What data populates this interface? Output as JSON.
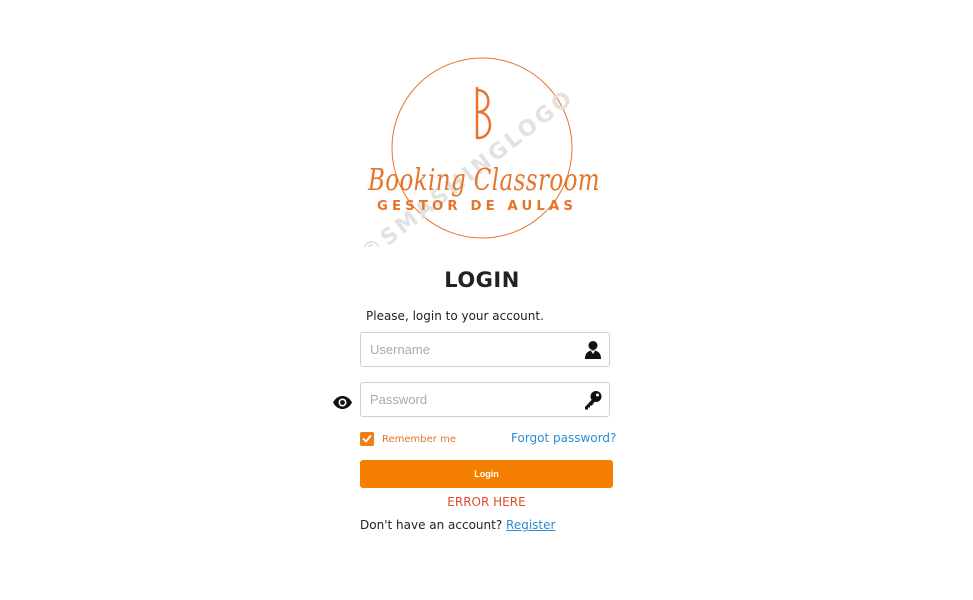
{
  "logo": {
    "title": "Booking Classroom",
    "subtitle": "GESTOR DE AULAS",
    "watermark": "©SMASHINGLOGO",
    "accent_color": "#e8742a"
  },
  "login": {
    "title": "LOGIN",
    "subtitle": "Please, login to your account.",
    "username_placeholder": "Username",
    "username_icon": "user-icon",
    "password_placeholder": "Password",
    "password_icon": "key-icon",
    "show_password_icon": "eye-icon",
    "remember_label": "Remember me",
    "remember_checked": true,
    "forgot_label": "Forgot password?",
    "button_label": "Login",
    "button_color": "#f57f00",
    "error_text": "ERROR HERE",
    "error_color": "#e04a2b",
    "no_account_text": "Don't have an account?",
    "register_label": "Register",
    "link_color": "#2b8ed6"
  }
}
